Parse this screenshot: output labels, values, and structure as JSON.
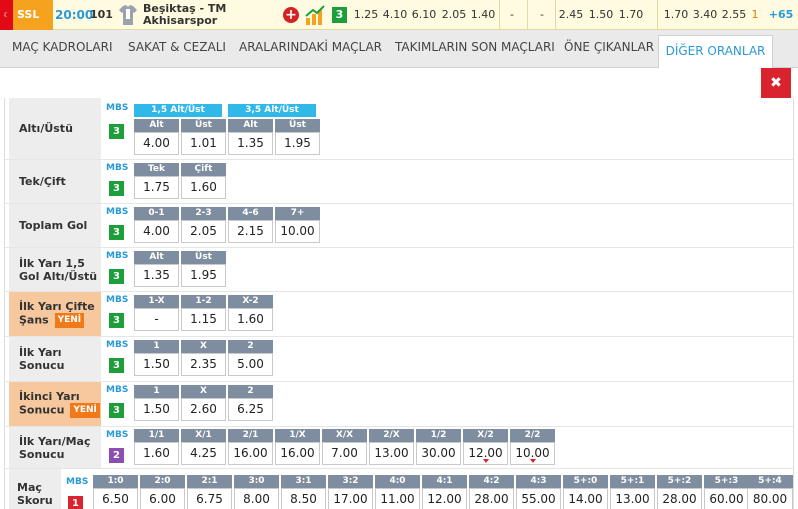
{
  "match": {
    "league": "SSL",
    "time": "20:00",
    "code": "101",
    "home": "Beşiktaş - TM",
    "away": "Akhisarspor",
    "mbs": "3",
    "odds": [
      "1.25",
      "4.10",
      "6.10",
      "2.05",
      "1.40",
      "-",
      "-",
      "2.45",
      "1.50",
      "1.70",
      "1.70",
      "3.40",
      "2.55",
      "1",
      "+65"
    ]
  },
  "tabs": [
    "MAÇ KADROLARI",
    "SAKAT & CEZALI",
    "ARALARINDAKİ MAÇLAR",
    "TAKIMLARIN SON MAÇLARI",
    "ÖNE ÇIKANLAR",
    "DİĞER ORANLAR"
  ],
  "active_tab": "DİĞER ORANLAR",
  "close_label": "✖",
  "mbs_caption": "MBS",
  "new_badge": "YENİ",
  "markets": [
    {
      "label": "Altı/Üstü",
      "mbs": "3",
      "groups": [
        "1,5 Alt/Üst",
        "3,5 Alt/Üst"
      ],
      "headers": [
        "Alt",
        "Üst",
        "Alt",
        "Üst"
      ],
      "values": [
        "4.00",
        "1.01",
        "1.35",
        "1.95"
      ]
    },
    {
      "label": "Tek/Çift",
      "mbs": "3",
      "headers": [
        "Tek",
        "Çift"
      ],
      "values": [
        "1.75",
        "1.60"
      ]
    },
    {
      "label": "Toplam Gol",
      "mbs": "3",
      "headers": [
        "0-1",
        "2-3",
        "4-6",
        "7+"
      ],
      "values": [
        "4.00",
        "2.05",
        "2.15",
        "10.00"
      ]
    },
    {
      "label": "İlk Yarı 1,5 Gol Altı/Üstü",
      "mbs": "3",
      "headers": [
        "Alt",
        "Üst"
      ],
      "values": [
        "1.35",
        "1.95"
      ]
    },
    {
      "label": "İlk Yarı Çifte Şans",
      "mbs": "3",
      "headers": [
        "1-X",
        "1-2",
        "X-2"
      ],
      "values": [
        "-",
        "1.15",
        "1.60"
      ]
    },
    {
      "label": "İlk Yarı Sonucu",
      "mbs": "3",
      "headers": [
        "1",
        "X",
        "2"
      ],
      "values": [
        "1.50",
        "2.35",
        "5.00"
      ]
    },
    {
      "label": "İkinci Yarı Sonucu",
      "mbs": "3",
      "headers": [
        "1",
        "X",
        "2"
      ],
      "values": [
        "1.50",
        "2.60",
        "6.25"
      ]
    },
    {
      "label": "İlk Yarı/Maç Sonucu",
      "mbs": "2",
      "headers": [
        "1/1",
        "X/1",
        "2/1",
        "1/X",
        "X/X",
        "2/X",
        "1/2",
        "X/2",
        "2/2"
      ],
      "values": [
        "1.60",
        "4.25",
        "16.00",
        "16.00",
        "7.00",
        "13.00",
        "30.00",
        "12.00",
        "10.00"
      ]
    },
    {
      "label": "Maç Skoru",
      "mbs": "1",
      "headers": [
        "1:0",
        "2:0",
        "2:1",
        "3:0",
        "3:1",
        "3:2",
        "4:0",
        "4:1",
        "4:2",
        "4:3",
        "5+:0",
        "5+:1",
        "5+:2",
        "5+:3",
        "5+:4"
      ],
      "values": [
        "6.50",
        "6.00",
        "6.75",
        "8.00",
        "8.50",
        "17.00",
        "11.00",
        "12.00",
        "28.00",
        "55.00",
        "14.00",
        "13.00",
        "28.00",
        "60.00",
        "80.00"
      ]
    }
  ]
}
